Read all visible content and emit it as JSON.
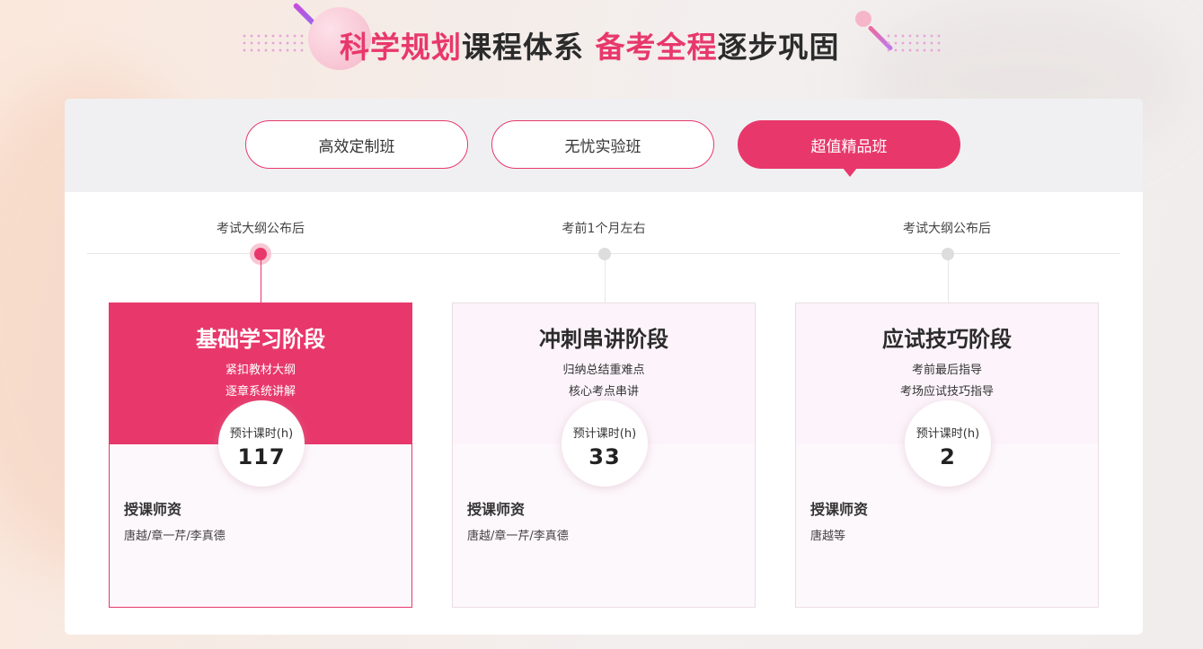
{
  "header": {
    "title_part1": "科学规划",
    "title_part2": "课程体系 ",
    "title_part3": "备考全程",
    "title_part4": "逐步巩固"
  },
  "tabs": [
    {
      "label": "高效定制班",
      "active": false
    },
    {
      "label": "无忧实验班",
      "active": false
    },
    {
      "label": "超值精品班",
      "active": true
    }
  ],
  "timeline": [
    {
      "label": "考试大纲公布后",
      "active": true
    },
    {
      "label": "考前1个月左右",
      "active": false
    },
    {
      "label": "考试大纲公布后",
      "active": false
    }
  ],
  "stages": [
    {
      "title": "基础学习阶段",
      "desc1": "紧扣教材大纲",
      "desc2": "逐章系统讲解",
      "hours_label": "预计课时(h)",
      "hours": "117",
      "teacher_title": "授课师资",
      "teachers": "唐越/章一芹/李真德",
      "active": true
    },
    {
      "title": "冲刺串讲阶段",
      "desc1": "归纳总结重难点",
      "desc2": "核心考点串讲",
      "hours_label": "预计课时(h)",
      "hours": "33",
      "teacher_title": "授课师资",
      "teachers": "唐越/章一芹/李真德",
      "active": false
    },
    {
      "title": "应试技巧阶段",
      "desc1": "考前最后指导",
      "desc2": "考场应试技巧指导",
      "hours_label": "预计课时(h)",
      "hours": "2",
      "teacher_title": "授课师资",
      "teachers": "唐越等",
      "active": false
    }
  ],
  "colors": {
    "accent": "#e8386b",
    "panel_bg": "#ffffff",
    "tabs_bg": "#f0f0f2"
  }
}
